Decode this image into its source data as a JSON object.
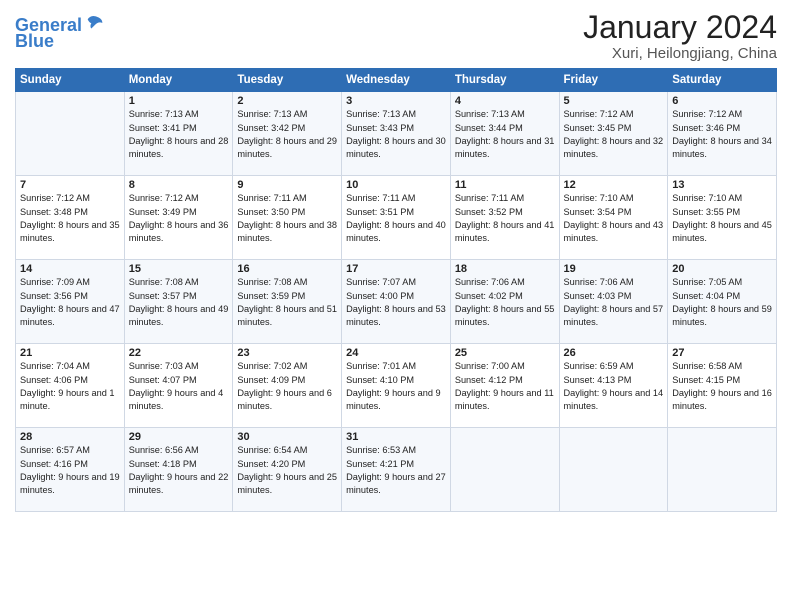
{
  "header": {
    "logo_general": "General",
    "logo_blue": "Blue",
    "month": "January 2024",
    "location": "Xuri, Heilongjiang, China"
  },
  "weekdays": [
    "Sunday",
    "Monday",
    "Tuesday",
    "Wednesday",
    "Thursday",
    "Friday",
    "Saturday"
  ],
  "weeks": [
    [
      {
        "day": "",
        "sunrise": "",
        "sunset": "",
        "daylight": ""
      },
      {
        "day": "1",
        "sunrise": "Sunrise: 7:13 AM",
        "sunset": "Sunset: 3:41 PM",
        "daylight": "Daylight: 8 hours and 28 minutes."
      },
      {
        "day": "2",
        "sunrise": "Sunrise: 7:13 AM",
        "sunset": "Sunset: 3:42 PM",
        "daylight": "Daylight: 8 hours and 29 minutes."
      },
      {
        "day": "3",
        "sunrise": "Sunrise: 7:13 AM",
        "sunset": "Sunset: 3:43 PM",
        "daylight": "Daylight: 8 hours and 30 minutes."
      },
      {
        "day": "4",
        "sunrise": "Sunrise: 7:13 AM",
        "sunset": "Sunset: 3:44 PM",
        "daylight": "Daylight: 8 hours and 31 minutes."
      },
      {
        "day": "5",
        "sunrise": "Sunrise: 7:12 AM",
        "sunset": "Sunset: 3:45 PM",
        "daylight": "Daylight: 8 hours and 32 minutes."
      },
      {
        "day": "6",
        "sunrise": "Sunrise: 7:12 AM",
        "sunset": "Sunset: 3:46 PM",
        "daylight": "Daylight: 8 hours and 34 minutes."
      }
    ],
    [
      {
        "day": "7",
        "sunrise": "Sunrise: 7:12 AM",
        "sunset": "Sunset: 3:48 PM",
        "daylight": "Daylight: 8 hours and 35 minutes."
      },
      {
        "day": "8",
        "sunrise": "Sunrise: 7:12 AM",
        "sunset": "Sunset: 3:49 PM",
        "daylight": "Daylight: 8 hours and 36 minutes."
      },
      {
        "day": "9",
        "sunrise": "Sunrise: 7:11 AM",
        "sunset": "Sunset: 3:50 PM",
        "daylight": "Daylight: 8 hours and 38 minutes."
      },
      {
        "day": "10",
        "sunrise": "Sunrise: 7:11 AM",
        "sunset": "Sunset: 3:51 PM",
        "daylight": "Daylight: 8 hours and 40 minutes."
      },
      {
        "day": "11",
        "sunrise": "Sunrise: 7:11 AM",
        "sunset": "Sunset: 3:52 PM",
        "daylight": "Daylight: 8 hours and 41 minutes."
      },
      {
        "day": "12",
        "sunrise": "Sunrise: 7:10 AM",
        "sunset": "Sunset: 3:54 PM",
        "daylight": "Daylight: 8 hours and 43 minutes."
      },
      {
        "day": "13",
        "sunrise": "Sunrise: 7:10 AM",
        "sunset": "Sunset: 3:55 PM",
        "daylight": "Daylight: 8 hours and 45 minutes."
      }
    ],
    [
      {
        "day": "14",
        "sunrise": "Sunrise: 7:09 AM",
        "sunset": "Sunset: 3:56 PM",
        "daylight": "Daylight: 8 hours and 47 minutes."
      },
      {
        "day": "15",
        "sunrise": "Sunrise: 7:08 AM",
        "sunset": "Sunset: 3:57 PM",
        "daylight": "Daylight: 8 hours and 49 minutes."
      },
      {
        "day": "16",
        "sunrise": "Sunrise: 7:08 AM",
        "sunset": "Sunset: 3:59 PM",
        "daylight": "Daylight: 8 hours and 51 minutes."
      },
      {
        "day": "17",
        "sunrise": "Sunrise: 7:07 AM",
        "sunset": "Sunset: 4:00 PM",
        "daylight": "Daylight: 8 hours and 53 minutes."
      },
      {
        "day": "18",
        "sunrise": "Sunrise: 7:06 AM",
        "sunset": "Sunset: 4:02 PM",
        "daylight": "Daylight: 8 hours and 55 minutes."
      },
      {
        "day": "19",
        "sunrise": "Sunrise: 7:06 AM",
        "sunset": "Sunset: 4:03 PM",
        "daylight": "Daylight: 8 hours and 57 minutes."
      },
      {
        "day": "20",
        "sunrise": "Sunrise: 7:05 AM",
        "sunset": "Sunset: 4:04 PM",
        "daylight": "Daylight: 8 hours and 59 minutes."
      }
    ],
    [
      {
        "day": "21",
        "sunrise": "Sunrise: 7:04 AM",
        "sunset": "Sunset: 4:06 PM",
        "daylight": "Daylight: 9 hours and 1 minute."
      },
      {
        "day": "22",
        "sunrise": "Sunrise: 7:03 AM",
        "sunset": "Sunset: 4:07 PM",
        "daylight": "Daylight: 9 hours and 4 minutes."
      },
      {
        "day": "23",
        "sunrise": "Sunrise: 7:02 AM",
        "sunset": "Sunset: 4:09 PM",
        "daylight": "Daylight: 9 hours and 6 minutes."
      },
      {
        "day": "24",
        "sunrise": "Sunrise: 7:01 AM",
        "sunset": "Sunset: 4:10 PM",
        "daylight": "Daylight: 9 hours and 9 minutes."
      },
      {
        "day": "25",
        "sunrise": "Sunrise: 7:00 AM",
        "sunset": "Sunset: 4:12 PM",
        "daylight": "Daylight: 9 hours and 11 minutes."
      },
      {
        "day": "26",
        "sunrise": "Sunrise: 6:59 AM",
        "sunset": "Sunset: 4:13 PM",
        "daylight": "Daylight: 9 hours and 14 minutes."
      },
      {
        "day": "27",
        "sunrise": "Sunrise: 6:58 AM",
        "sunset": "Sunset: 4:15 PM",
        "daylight": "Daylight: 9 hours and 16 minutes."
      }
    ],
    [
      {
        "day": "28",
        "sunrise": "Sunrise: 6:57 AM",
        "sunset": "Sunset: 4:16 PM",
        "daylight": "Daylight: 9 hours and 19 minutes."
      },
      {
        "day": "29",
        "sunrise": "Sunrise: 6:56 AM",
        "sunset": "Sunset: 4:18 PM",
        "daylight": "Daylight: 9 hours and 22 minutes."
      },
      {
        "day": "30",
        "sunrise": "Sunrise: 6:54 AM",
        "sunset": "Sunset: 4:20 PM",
        "daylight": "Daylight: 9 hours and 25 minutes."
      },
      {
        "day": "31",
        "sunrise": "Sunrise: 6:53 AM",
        "sunset": "Sunset: 4:21 PM",
        "daylight": "Daylight: 9 hours and 27 minutes."
      },
      {
        "day": "",
        "sunrise": "",
        "sunset": "",
        "daylight": ""
      },
      {
        "day": "",
        "sunrise": "",
        "sunset": "",
        "daylight": ""
      },
      {
        "day": "",
        "sunrise": "",
        "sunset": "",
        "daylight": ""
      }
    ]
  ]
}
